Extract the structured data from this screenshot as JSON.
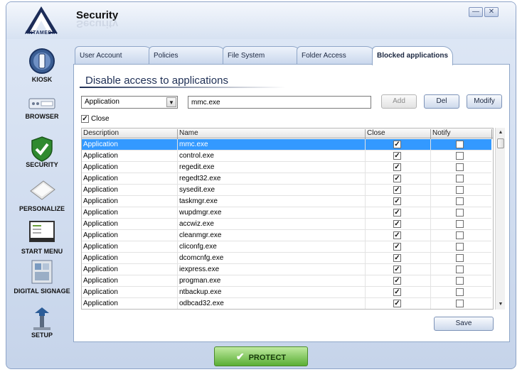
{
  "window": {
    "title": "Security",
    "logo_text": "ANTAMEDIA",
    "minimize_label": "—",
    "close_label": "✕"
  },
  "sidebar": {
    "items": [
      {
        "label": "KIOSK",
        "icon": "kiosk-icon"
      },
      {
        "label": "BROWSER",
        "icon": "browser-icon"
      },
      {
        "label": "SECURITY",
        "icon": "security-shield-icon"
      },
      {
        "label": "PERSONALIZE",
        "icon": "personalize-icon"
      },
      {
        "label": "START MENU",
        "icon": "start-menu-icon"
      },
      {
        "label": "DIGITAL SIGNAGE",
        "icon": "digital-signage-icon"
      },
      {
        "label": "SETUP",
        "icon": "setup-icon"
      }
    ]
  },
  "tabs": [
    {
      "label": "User Account"
    },
    {
      "label": "Policies"
    },
    {
      "label": "File System"
    },
    {
      "label": "Folder Access"
    },
    {
      "label": "Blocked applications",
      "active": true
    }
  ],
  "panel": {
    "heading": "Disable access to applications",
    "type_select": {
      "value": "Application",
      "arrow": "▼"
    },
    "name_input": {
      "value": "mmc.exe"
    },
    "buttons": {
      "add": "Add",
      "del": "Del",
      "modify": "Modify"
    },
    "close_checkbox": {
      "label": "Close",
      "checked": true,
      "mark": "✓"
    },
    "save_label": "Save"
  },
  "table": {
    "columns": [
      "Description",
      "Name",
      "Close",
      "Notify"
    ],
    "check_mark": "✓",
    "rows": [
      {
        "description": "Application",
        "name": "mmc.exe",
        "close": true,
        "notify": false,
        "selected": true
      },
      {
        "description": "Application",
        "name": "control.exe",
        "close": true,
        "notify": false
      },
      {
        "description": "Application",
        "name": "regedit.exe",
        "close": true,
        "notify": false
      },
      {
        "description": "Application",
        "name": "regedt32.exe",
        "close": true,
        "notify": false
      },
      {
        "description": "Application",
        "name": "sysedit.exe",
        "close": true,
        "notify": false
      },
      {
        "description": "Application",
        "name": "taskmgr.exe",
        "close": true,
        "notify": false
      },
      {
        "description": "Application",
        "name": "wupdmgr.exe",
        "close": true,
        "notify": false
      },
      {
        "description": "Application",
        "name": "accwiz.exe",
        "close": true,
        "notify": false
      },
      {
        "description": "Application",
        "name": "cleanmgr.exe",
        "close": true,
        "notify": false
      },
      {
        "description": "Application",
        "name": "cliconfg.exe",
        "close": true,
        "notify": false
      },
      {
        "description": "Application",
        "name": "dcomcnfg.exe",
        "close": true,
        "notify": false
      },
      {
        "description": "Application",
        "name": "iexpress.exe",
        "close": true,
        "notify": false
      },
      {
        "description": "Application",
        "name": "progman.exe",
        "close": true,
        "notify": false
      },
      {
        "description": "Application",
        "name": "ntbackup.exe",
        "close": true,
        "notify": false
      },
      {
        "description": "Application",
        "name": "odbcad32.exe",
        "close": true,
        "notify": false
      }
    ]
  },
  "scrollbar": {
    "up": "▲",
    "down": "▼"
  },
  "footer": {
    "protect_label": "PROTECT",
    "protect_check": "✔"
  },
  "colors": {
    "selection": "#3399ff",
    "protect": "#5aae35",
    "accent": "#1e2f55"
  }
}
